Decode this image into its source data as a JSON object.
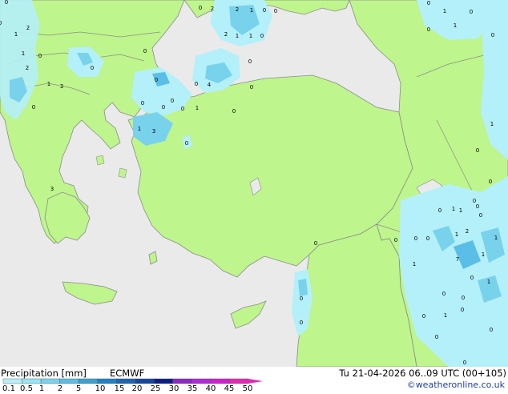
{
  "legend": {
    "title": "Precipitation [mm]",
    "model": "ECMWF",
    "valid_time": "Tu 21-04-2026 06..09 UTC (00+105)",
    "credit": "©weatheronline.co.uk",
    "ticks": [
      "0.1",
      "0.5",
      "1",
      "2",
      "5",
      "10",
      "15",
      "20",
      "25",
      "30",
      "35",
      "40",
      "45",
      "50"
    ],
    "colors": [
      "#b4f0fa",
      "#96e6f5",
      "#78d2eb",
      "#5abee6",
      "#3ca0d2",
      "#1e82c8",
      "#1e64b4",
      "#1446a0",
      "#0a1e8c",
      "#8c28c8",
      "#b428dc",
      "#d21ed2",
      "#e628b4"
    ]
  },
  "map": {
    "colors": {
      "sea": "#eaeaea",
      "land": "#bef58c",
      "border": "#8c8c8c",
      "rain_light": "#b4f0fa",
      "rain_mid": "#78d2eb",
      "rain_heavy": "#5abee6"
    },
    "values": [
      "0",
      "2",
      "2",
      "1",
      "0",
      "0",
      "2",
      "1",
      "1",
      "0",
      "0",
      "4",
      "0",
      "0",
      "0",
      "1",
      "0",
      "0",
      "2",
      "0",
      "0",
      "1",
      "0",
      "2",
      "1",
      "3",
      "0",
      "0",
      "0",
      "0",
      "1",
      "3",
      "3",
      "0",
      "1",
      "0",
      "0",
      "0",
      "1",
      "1",
      "0",
      "0",
      "0",
      "0",
      "0",
      "0",
      "1",
      "0",
      "1",
      "2",
      "1",
      "7",
      "0",
      "0",
      "1",
      "1",
      "0",
      "0",
      "0",
      "0",
      "1",
      "0",
      "0",
      "0",
      "1",
      "0",
      "0",
      "0",
      "0",
      "0",
      "0",
      "0",
      "1",
      "1"
    ]
  }
}
